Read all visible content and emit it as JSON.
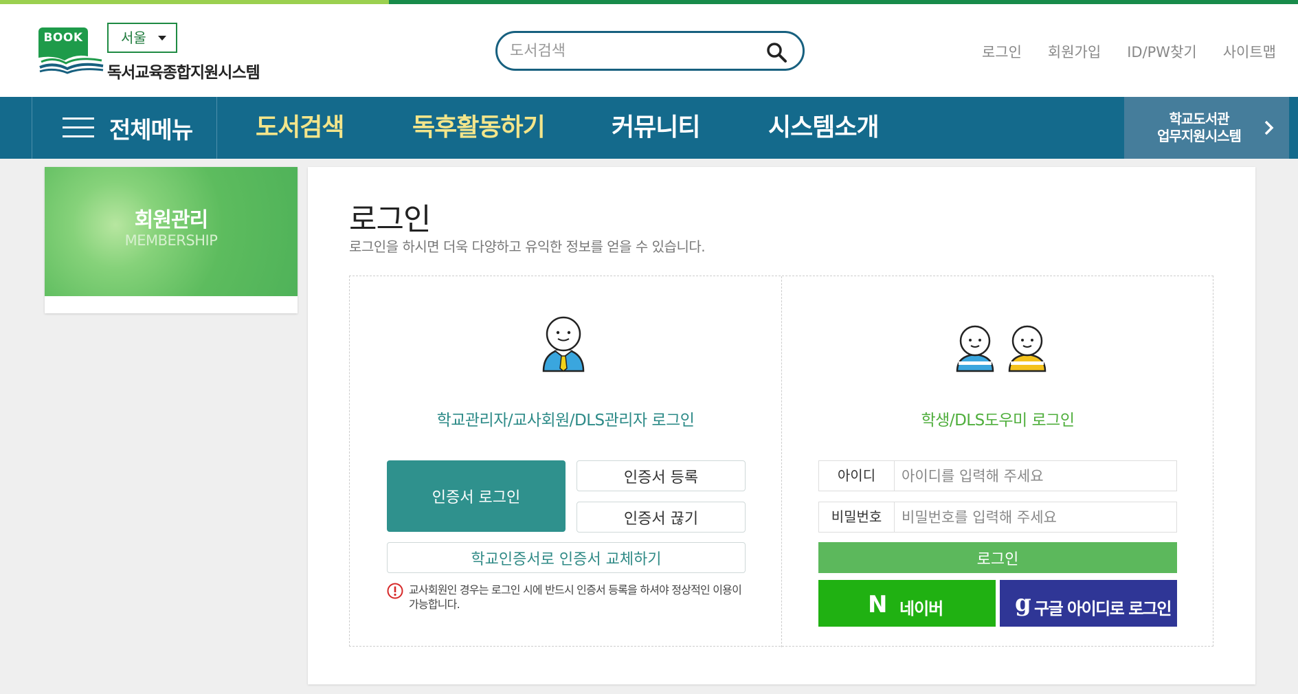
{
  "header": {
    "logo_badge": "BOOK",
    "region": "서울",
    "site_name": "독서교육종합지원시스템",
    "search_placeholder": "도서검색",
    "top_links": [
      "로그인",
      "회원가입",
      "ID/PW찾기",
      "사이트맵"
    ]
  },
  "nav": {
    "all_menu": "전체메뉴",
    "items": [
      "도서검색",
      "독후활동하기",
      "커뮤니티",
      "시스템소개"
    ],
    "side_button_line1": "학교도서관",
    "side_button_line2": "업무지원시스템"
  },
  "sidebar": {
    "title": "회원관리",
    "subtitle": "MEMBERSHIP"
  },
  "page": {
    "title": "로그인",
    "description": "로그인을 하시면 더욱 다양하고 유익한 정보를 얻을 수 있습니다."
  },
  "teacher_login": {
    "title": "학교관리자/교사회원/DLS관리자 로그인",
    "cert_login": "인증서 로그인",
    "cert_register": "인증서 등록",
    "cert_unlink": "인증서 끊기",
    "cert_replace": "학교인증서로 인증서 교체하기",
    "notice": "교사회원인 경우는 로그인 시에 반드시 인증서 등록을 하셔야 정상적인 이용이 가능합니다."
  },
  "student_login": {
    "title": "학생/DLS도우미 로그인",
    "id_label": "아이디",
    "id_placeholder": "아이디를 입력해 주세요",
    "pw_label": "비밀번호",
    "pw_placeholder": "비밀번호를 입력해 주세요",
    "login_button": "로그인",
    "naver_logo": "N",
    "naver_label": "네이버",
    "google_logo": "g",
    "google_label": "구글 아이디로 로그인"
  },
  "colors": {
    "nav_bg": "#146a8c",
    "nav_highlight": "#f3e58a",
    "teacher_accent": "#2f918d",
    "student_accent": "#5cb85c",
    "naver": "#20b112",
    "google": "#2f3696"
  },
  "icons": [
    "book-logo-icon",
    "search-icon",
    "menu-icon",
    "chevron-right-icon",
    "teacher-icon",
    "students-icon",
    "warning-icon",
    "naver-icon",
    "google-icon"
  ]
}
